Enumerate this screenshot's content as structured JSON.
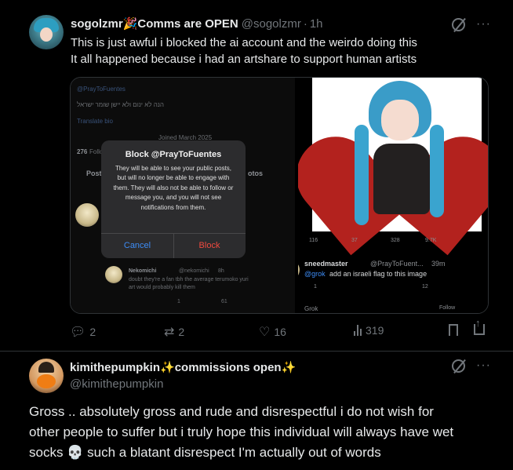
{
  "post1": {
    "author": "sogolzmr",
    "author_emoji": "🎉",
    "author_suffix": "Comms are OPEN",
    "handle": "@sogolzmr",
    "time": "1h",
    "text_line1": "This is just awful i blocked the ai account and the weirdo doing this",
    "text_line2": "It all happened because i had an artshare to support human artists",
    "media": {
      "left": {
        "faded_handle": "@PrayToFuentes",
        "faded_bio": "הנה לא ינום ולא יישן שומר ישראל",
        "translate": "Translate bio",
        "joined": "Joined March 2025",
        "following_count": "276",
        "following_label": "Following",
        "tab_posts": "Post",
        "tab_photos": "otos",
        "dialog_title": "Block @PrayToFuentes",
        "dialog_message": "They will be able to see your public posts, but will no longer be able to engage with them. They will also not be able to follow or message you, and you will not see notifications from them.",
        "cancel": "Cancel",
        "block": "Block",
        "reply_name": "Nekomichi",
        "reply_handle": "@nekomichi",
        "reply_time": "8h",
        "reply_line1": "doubt they're a fan tbh the average terumoko yuri",
        "reply_line2": "art would probably kill them",
        "reply_stat_a": "1",
        "reply_stat_b": "61"
      },
      "right": {
        "stat_replies": "116",
        "stat_rts": "37",
        "stat_likes": "328",
        "stat_views": "9.7K",
        "reply_name": "sneedmaster",
        "reply_handle": "@PrayToFuent...",
        "reply_time": "39m",
        "reply_mention": "@grok",
        "reply_text": "add an israeli flag to this image",
        "reply_stat_replies": "1",
        "reply_stat_views": "12",
        "nav_label": "Grok",
        "follow_label": "Follow"
      }
    },
    "actions": {
      "replies": "2",
      "reposts": "2",
      "likes": "16",
      "views": "319"
    }
  },
  "post2": {
    "author": "kimithepumpkin",
    "author_spark": "✨",
    "author_suffix": "commissions open",
    "author_spark2": "✨",
    "handle": "@kimithepumpkin",
    "text_line1": "Gross .. absolutely gross and rude and disrespectful i do not wish for",
    "text_line2": "other people to suffer but i truly hope this individual will always have wet",
    "text_line3a": "socks",
    "text_emoji": "💀",
    "text_line3b": "such a blatant disrespect I'm actually out of words"
  },
  "icons": {
    "grok": "grok-icon",
    "more": "more-icon",
    "reply": "reply-icon",
    "repost": "repost-icon",
    "like": "heart-icon",
    "views": "views-icon",
    "bookmark": "bookmark-icon",
    "share": "share-icon"
  },
  "colors": {
    "background": "#000000",
    "text": "#e7e9ea",
    "muted": "#71767b",
    "divider": "#2f3336",
    "dialog_cancel": "#3d8cf5",
    "dialog_block": "#f04a3f"
  }
}
